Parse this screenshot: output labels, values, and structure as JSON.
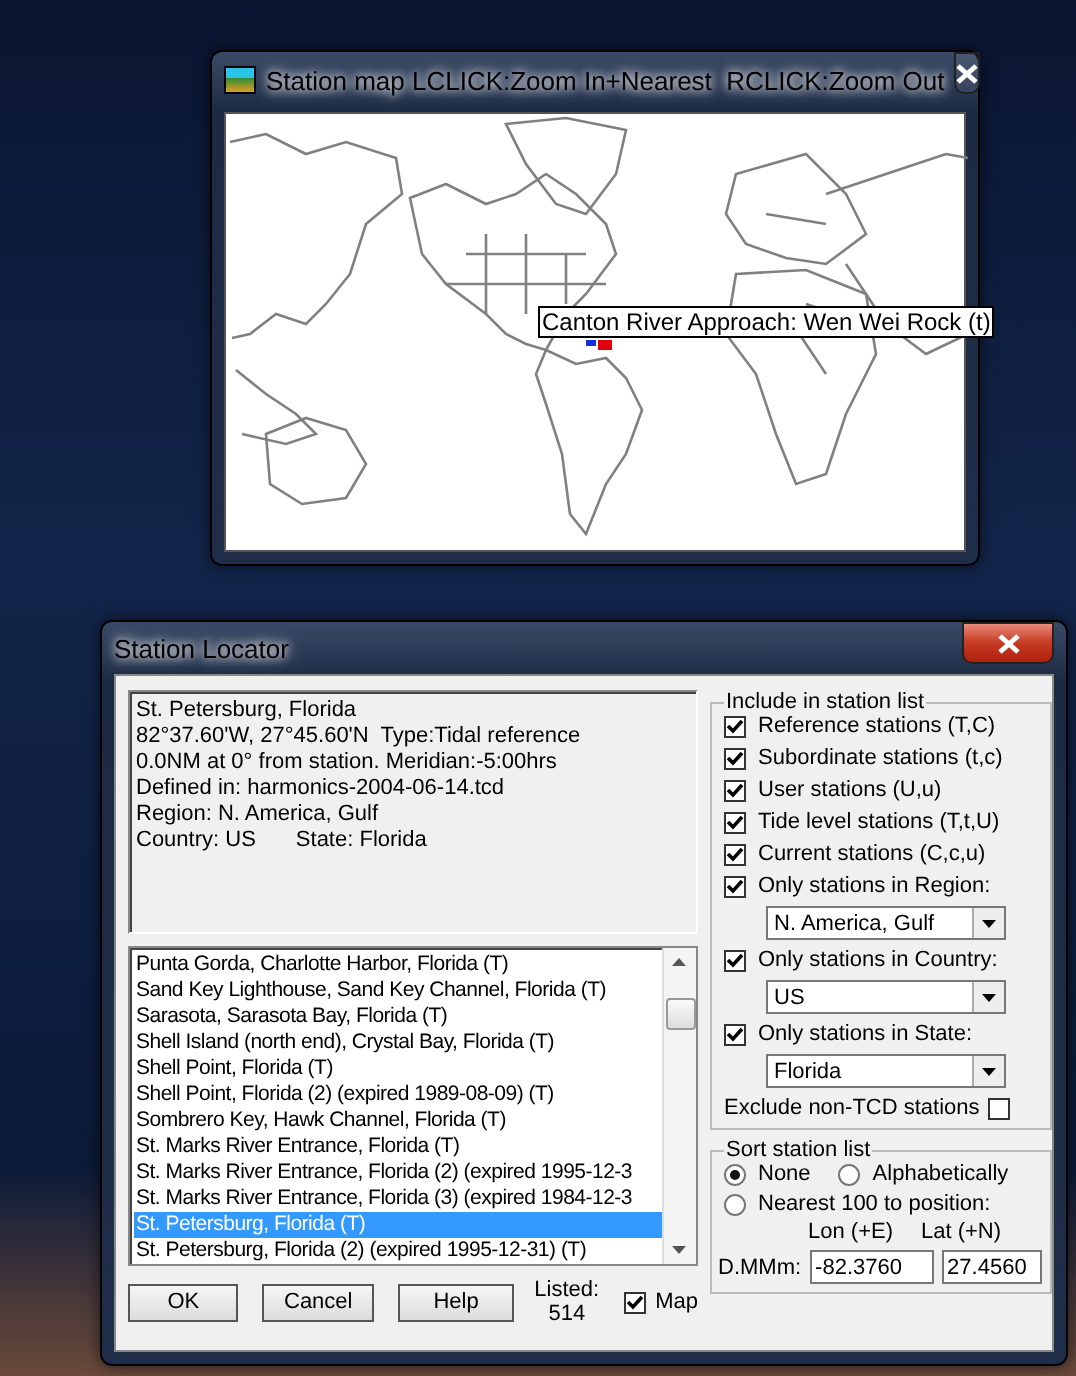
{
  "map_window": {
    "title": "Station map LCLICK:Zoom In+Nearest  RCLICK:Zoom Out",
    "tooltip": "Canton River Approach: Wen Wei Rock (t)"
  },
  "locator": {
    "title": "Station Locator",
    "info_lines": [
      "St. Petersburg, Florida",
      "82°37.60'W, 27°45.60'N  Type:Tidal reference",
      "0.0NM at 0° from station. Meridian:-5:00hrs",
      "Defined in: harmonics-2004-06-14.tcd",
      "Region: N. America, Gulf"
    ],
    "country": "Country: US",
    "state": "State: Florida",
    "stations": [
      {
        "name": "Punta Gorda, Charlotte Harbor, Florida (T)",
        "selected": false
      },
      {
        "name": "Sand Key Lighthouse, Sand Key Channel, Florida (T)",
        "selected": false
      },
      {
        "name": "Sarasota, Sarasota Bay, Florida (T)",
        "selected": false
      },
      {
        "name": "Shell Island (north end), Crystal Bay, Florida (T)",
        "selected": false
      },
      {
        "name": "Shell Point, Florida (T)",
        "selected": false
      },
      {
        "name": "Shell Point, Florida (2) (expired 1989-08-09) (T)",
        "selected": false
      },
      {
        "name": "Sombrero Key, Hawk Channel, Florida (T)",
        "selected": false
      },
      {
        "name": "St. Marks River Entrance, Florida (T)",
        "selected": false
      },
      {
        "name": "St. Marks River Entrance, Florida (2) (expired 1995-12-3",
        "selected": false
      },
      {
        "name": "St. Marks River Entrance, Florida (3) (expired 1984-12-3",
        "selected": false
      },
      {
        "name": "St. Petersburg, Florida (T)",
        "selected": true
      },
      {
        "name": "St. Petersburg, Florida (2) (expired 1995-12-31) (T)",
        "selected": false
      }
    ],
    "buttons": [
      "OK",
      "Cancel",
      "Help"
    ],
    "listed_label": "Listed:",
    "listed_count": "514",
    "map_toggle": {
      "label": "Map",
      "checked": true
    },
    "include": {
      "title": "Include in station list",
      "options": [
        {
          "kind": "checkbox",
          "label": "Reference stations (T,C)",
          "checked": true
        },
        {
          "kind": "checkbox",
          "label": "Subordinate stations (t,c)",
          "checked": true
        },
        {
          "kind": "checkbox",
          "label": "User stations (U,u)",
          "checked": true
        },
        {
          "kind": "checkbox",
          "label": "Tide level stations (T,t,U)",
          "checked": true
        },
        {
          "kind": "checkbox",
          "label": "Current stations (C,c,u)",
          "checked": true
        },
        {
          "kind": "checkbox",
          "label": "Only stations in Region:",
          "checked": true
        },
        {
          "kind": "dropdown",
          "value": "N. America, Gulf"
        },
        {
          "kind": "checkbox",
          "label": "Only stations in Country:",
          "checked": true
        },
        {
          "kind": "dropdown",
          "value": "US"
        },
        {
          "kind": "checkbox",
          "label": "Only stations in State:",
          "checked": true
        },
        {
          "kind": "dropdown",
          "value": "Florida"
        }
      ],
      "exclude": {
        "label": "Exclude non-TCD stations",
        "checked": false
      }
    },
    "sort": {
      "title": "Sort station list",
      "options": [
        {
          "label": "None",
          "selected": true
        },
        {
          "label": "Alphabetically",
          "selected": false
        },
        {
          "label": "Nearest 100 to position:",
          "selected": false
        }
      ],
      "lon_label": "Lon (+E)",
      "lat_label": "Lat (+N)",
      "units_label": "D.MMm:",
      "lon": "-82.3760",
      "lat": "27.4560"
    }
  }
}
